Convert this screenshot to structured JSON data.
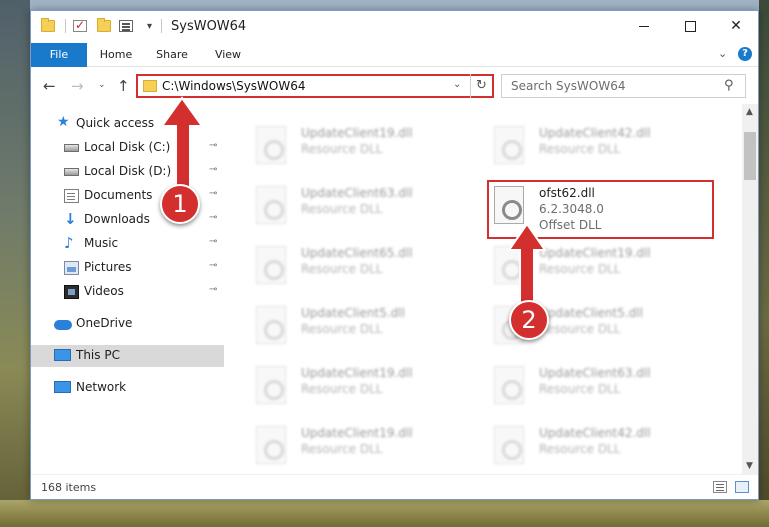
{
  "window": {
    "title": "SysWOW64",
    "close_glyph": "✕"
  },
  "ribbon": {
    "tabs": [
      "File",
      "Home",
      "Share",
      "View"
    ],
    "help_glyph": "?"
  },
  "navigation": {
    "back_glyph": "←",
    "forward_glyph": "→",
    "recent_glyph": "⌄",
    "up_glyph": "↑",
    "address_path": "C:\\Windows\\SysWOW64",
    "address_dropdown_glyph": "⌄",
    "refresh_glyph": "↻",
    "search_placeholder": "Search SysWOW64",
    "search_glyph": "⚲"
  },
  "sidebar": {
    "pin_glyph": "📌",
    "items": [
      {
        "label": "Quick access",
        "icon": "star-icon",
        "pinned": false
      },
      {
        "label": "Local Disk (C:)",
        "icon": "drive-icon",
        "pinned": true
      },
      {
        "label": "Local Disk (D:)",
        "icon": "drive-icon",
        "pinned": true
      },
      {
        "label": "Documents",
        "icon": "documents-icon",
        "pinned": true
      },
      {
        "label": "Downloads",
        "icon": "downloads-icon",
        "pinned": true
      },
      {
        "label": "Music",
        "icon": "music-icon",
        "pinned": true
      },
      {
        "label": "Pictures",
        "icon": "pictures-icon",
        "pinned": true
      },
      {
        "label": "Videos",
        "icon": "videos-icon",
        "pinned": true
      },
      {
        "label": "OneDrive",
        "icon": "onedrive-icon",
        "pinned": false
      },
      {
        "label": "This PC",
        "icon": "this-pc-icon",
        "pinned": false,
        "selected": true
      },
      {
        "label": "Network",
        "icon": "network-icon",
        "pinned": false
      }
    ]
  },
  "files": {
    "left_column": [
      {
        "name": "UpdateClient19.dll",
        "type": "Resource DLL"
      },
      {
        "name": "UpdateClient63.dll",
        "type": "Resource DLL"
      },
      {
        "name": "UpdateClient65.dll",
        "type": "Resource DLL"
      },
      {
        "name": "UpdateClient5.dll",
        "type": "Resource DLL"
      },
      {
        "name": "UpdateClient19.dll",
        "type": "Resource DLL"
      },
      {
        "name": "UpdateClient19.dll",
        "type": "Resource DLL"
      }
    ],
    "right_column": [
      {
        "name": "UpdateClient42.dll",
        "type": "Resource DLL"
      },
      {
        "name": "UpdateClient19.dll",
        "type": "Resource DLL"
      },
      {
        "name": "UpdateClient5.dll",
        "type": "Resource DLL"
      },
      {
        "name": "UpdateClient63.dll",
        "type": "Resource DLL"
      },
      {
        "name": "UpdateClient42.dll",
        "type": "Resource DLL"
      }
    ],
    "highlighted": {
      "name": "ofst62.dll",
      "version": "6.2.3048.0",
      "type": "Offset DLL"
    }
  },
  "scrollbar": {
    "up_glyph": "▲",
    "down_glyph": "▼"
  },
  "status": {
    "item_count": "168 items"
  },
  "annotations": {
    "step1": "1",
    "step2": "2",
    "color": "#d32f2f"
  }
}
